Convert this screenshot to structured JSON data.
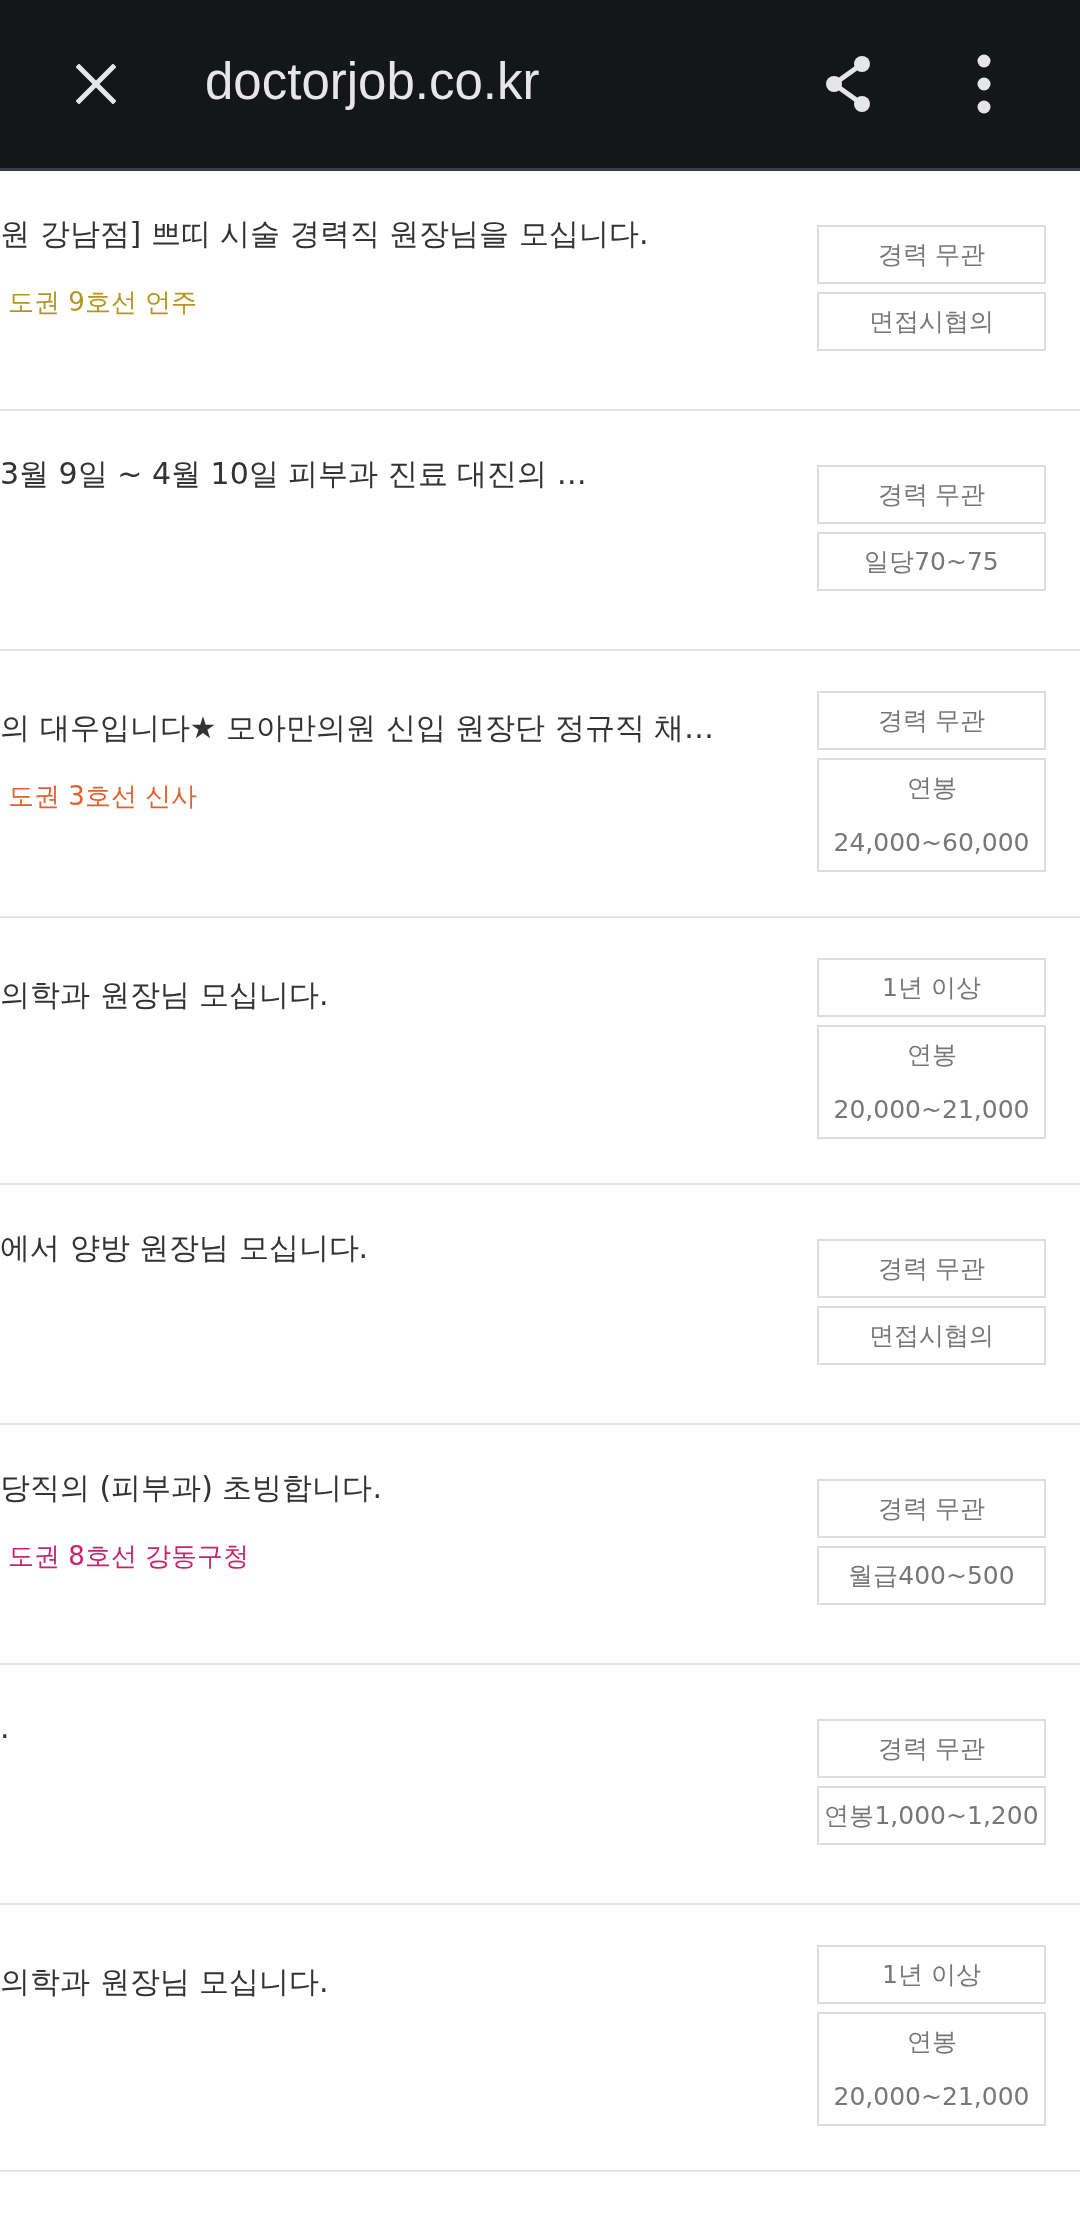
{
  "toolbar": {
    "title": "doctorjob.co.kr"
  },
  "rows": [
    {
      "title": "원 강남점] 쁘띠 시술 경력직 원장님을 모십니다.",
      "location": {
        "text": "도권 9호선 언주",
        "color": "#b5961f"
      },
      "tags": [
        "경력 무관",
        "면접시협의"
      ]
    },
    {
      "title": "3월 9일 ~ 4월 10일 피부과 진료 대진의 …",
      "tags": [
        "경력 무관",
        "일당70~75"
      ]
    },
    {
      "title": "의 대우입니다★ 모아만의원 신입 원장단 정규직 채…",
      "location": {
        "text": "도권 3호선 신사",
        "color": "#e0622e"
      },
      "tags": [
        "경력 무관",
        "연봉 24,000~60,000"
      ]
    },
    {
      "title": "의학과 원장님 모십니다.",
      "tags": [
        "1년 이상",
        "연봉 20,000~21,000"
      ]
    },
    {
      "title": "에서 양방 원장님 모십니다.",
      "tags": [
        "경력 무관",
        "면접시협의"
      ]
    },
    {
      "title": "당직의 (피부과) 초빙합니다.",
      "location": {
        "text": "도권 8호선 강동구청",
        "color": "#c8246c"
      },
      "tags": [
        "경력 무관",
        "월급400~500"
      ]
    },
    {
      "title": ".",
      "tags": [
        "경력 무관",
        "연봉1,000~1,200"
      ]
    },
    {
      "title": "의학과 원장님 모십니다.",
      "tags": [
        "1년 이상",
        "연봉 20,000~21,000"
      ]
    }
  ]
}
